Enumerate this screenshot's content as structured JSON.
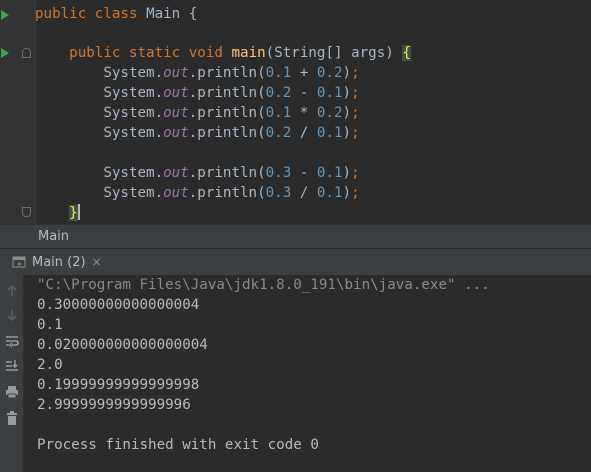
{
  "editor": {
    "lines": [
      {
        "type": "class",
        "kw1": "public",
        "kw2": "class",
        "name": "Main",
        "brace": "{"
      },
      {
        "type": "method",
        "kw1": "public",
        "kw2": "static",
        "kw3": "void",
        "name": "main",
        "params": "(String[] args) ",
        "brace": "{"
      },
      {
        "type": "stmt",
        "recv": "System.",
        "field": "out",
        "call": ".println(",
        "a": "0.1",
        "op": " + ",
        "b": "0.2",
        "close": ")",
        "semi": ";"
      },
      {
        "type": "stmt",
        "recv": "System.",
        "field": "out",
        "call": ".println(",
        "a": "0.2",
        "op": " - ",
        "b": "0.1",
        "close": ")",
        "semi": ";"
      },
      {
        "type": "stmt",
        "recv": "System.",
        "field": "out",
        "call": ".println(",
        "a": "0.1",
        "op": " * ",
        "b": "0.2",
        "close": ")",
        "semi": ";"
      },
      {
        "type": "stmt",
        "recv": "System.",
        "field": "out",
        "call": ".println(",
        "a": "0.2",
        "op": " / ",
        "b": "0.1",
        "close": ")",
        "semi": ";"
      },
      {
        "type": "stmt",
        "recv": "System.",
        "field": "out",
        "call": ".println(",
        "a": "0.3",
        "op": " - ",
        "b": "0.1",
        "close": ")",
        "semi": ";"
      },
      {
        "type": "stmt",
        "recv": "System.",
        "field": "out",
        "call": ".println(",
        "a": "0.3",
        "op": " / ",
        "b": "0.1",
        "close": ")",
        "semi": ";"
      },
      {
        "type": "close",
        "brace": "}"
      }
    ]
  },
  "breadcrumb": {
    "label": "Main"
  },
  "run_panel": {
    "tab_label": "Main (2)",
    "tab_close": "×",
    "output": [
      "\"C:\\Program Files\\Java\\jdk1.8.0_191\\bin\\java.exe\" ...",
      "0.30000000000000004",
      "0.1",
      "0.020000000000000004",
      "2.0",
      "0.19999999999999998",
      "2.9999999999999996",
      "",
      "Process finished with exit code 0"
    ]
  },
  "toolbar": {
    "icons": [
      "up-arrow-icon",
      "down-arrow-icon",
      "soft-wrap-icon",
      "scroll-to-end-icon",
      "print-icon",
      "trash-icon"
    ]
  },
  "colors": {
    "editor_bg": "#2b2b2b",
    "keyword": "#cc7832",
    "method_name": "#ffc66d",
    "field": "#9876aa",
    "number": "#6897bb",
    "text": "#a9b7c6",
    "run_green": "#499c54"
  }
}
